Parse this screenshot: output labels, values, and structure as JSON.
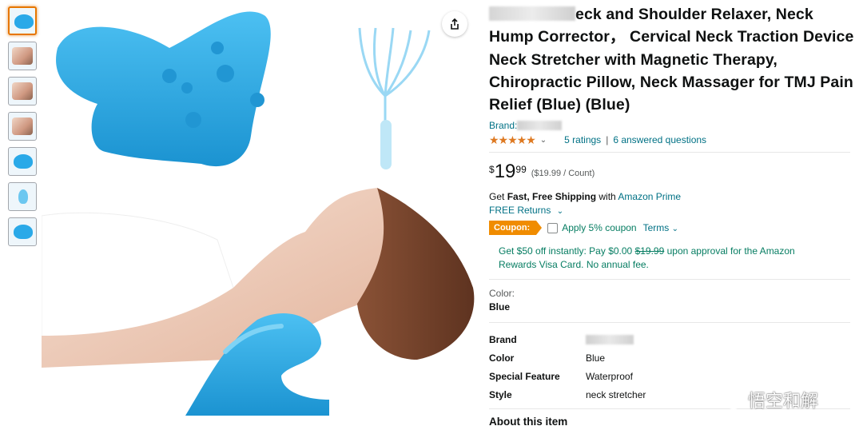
{
  "product": {
    "title": "eck and Shoulder Relaxer, Neck Hump Corrector， Cervical Neck Traction Device Neck Stretcher with Magnetic Therapy, Chiropractic Pillow, Neck Massager for TMJ Pain Relief (Blue) (Blue)",
    "brand_label": "Brand:",
    "stars_value": 5,
    "ratings_text": "5 ratings",
    "questions_text": "6 answered questions"
  },
  "price": {
    "symbol": "$",
    "whole": "19",
    "fraction": "99",
    "per_unit": "($19.99 / Count)"
  },
  "shipping": {
    "prefix": "Get ",
    "bold": "Fast, Free Shipping",
    "with": " with ",
    "link": "Amazon Prime",
    "returns": "FREE Returns"
  },
  "coupon": {
    "badge": "Coupon:",
    "label": "Apply 5% coupon",
    "terms": "Terms"
  },
  "offer": {
    "text_a": "Get $50 off instantly: Pay $0.00 ",
    "strike": "$19.99",
    "text_b": " upon approval for the Amazon Rewards Visa Card. No annual fee."
  },
  "color": {
    "label": "Color:",
    "value": "Blue"
  },
  "specs": [
    {
      "key": "Brand",
      "value": ""
    },
    {
      "key": "Color",
      "value": "Blue"
    },
    {
      "key": "Special Feature",
      "value": "Waterproof"
    },
    {
      "key": "Style",
      "value": "neck stretcher"
    }
  ],
  "about_heading": "About this item",
  "watermark": "悟空和解",
  "colors": {
    "link": "#007185",
    "accent_orange": "#f08c00",
    "green": "#067d62",
    "product_blue": "#2aa9e8"
  }
}
